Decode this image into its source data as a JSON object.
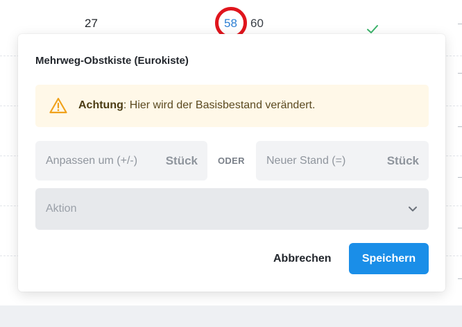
{
  "background": {
    "row_values": {
      "col1": "27",
      "col2": "58",
      "col3": "60"
    },
    "check_icon": "check-icon"
  },
  "modal": {
    "title": "Mehrweg-Obstkiste (Eurokiste)",
    "warning": {
      "icon": "warning-triangle-icon",
      "label_strong": "Achtung",
      "text": ": Hier wird der Basisbestand verändert."
    },
    "adjust_field": {
      "placeholder": "Anpassen um (+/-)",
      "unit": "Stück"
    },
    "separator": "ODER",
    "new_stock_field": {
      "placeholder": "Neuer Stand (=)",
      "unit": "Stück"
    },
    "action_select": {
      "placeholder": "Aktion",
      "icon": "chevron-down-icon"
    },
    "buttons": {
      "cancel_label": "Abbrechen",
      "save_label": "Speichern"
    }
  },
  "colors": {
    "primary": "#1a8ee8",
    "warning_bg": "#fff8e8",
    "warning_icon": "#f0a21c",
    "highlight_ring": "#e0151d",
    "link": "#2d7fd3",
    "success": "#3bb36a"
  }
}
